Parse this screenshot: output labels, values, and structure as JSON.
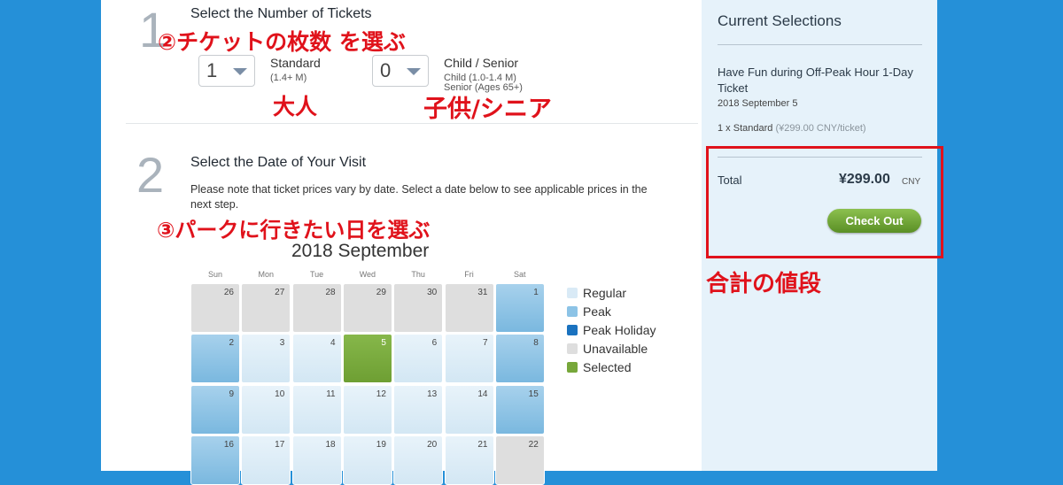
{
  "steps": {
    "step1": {
      "number": "1",
      "title": "Select the Number of Tickets",
      "standard": {
        "qty": "1",
        "label": "Standard",
        "sub": "(1.4+ M)"
      },
      "child": {
        "qty": "0",
        "label": "Child / Senior",
        "sub1": "Child (1.0-1.4 M)",
        "sub2": "Senior (Ages 65+)"
      }
    },
    "step2": {
      "number": "2",
      "title": "Select the Date of Your Visit",
      "note": "Please note that ticket prices vary by date. Select a date below to see applicable prices in the next step."
    }
  },
  "annotations": {
    "step2_jp": "②チケットの枚数 を選ぶ",
    "adult_jp": "大人",
    "child_jp": "子供/シニア",
    "step3_jp": "③パークに行きたい日を選ぶ",
    "total_jp": "合計の値段"
  },
  "calendar": {
    "title": "2018 September",
    "weekdays": [
      "Sun",
      "Mon",
      "Tue",
      "Wed",
      "Thu",
      "Fri",
      "Sat"
    ],
    "weeks": [
      [
        {
          "d": "26",
          "s": "unavailable"
        },
        {
          "d": "27",
          "s": "unavailable"
        },
        {
          "d": "28",
          "s": "unavailable"
        },
        {
          "d": "29",
          "s": "unavailable"
        },
        {
          "d": "30",
          "s": "unavailable"
        },
        {
          "d": "31",
          "s": "unavailable"
        },
        {
          "d": "1",
          "s": "peak"
        }
      ],
      [
        {
          "d": "2",
          "s": "peak"
        },
        {
          "d": "3",
          "s": "regular"
        },
        {
          "d": "4",
          "s": "regular"
        },
        {
          "d": "5",
          "s": "selected"
        },
        {
          "d": "6",
          "s": "regular"
        },
        {
          "d": "7",
          "s": "regular"
        },
        {
          "d": "8",
          "s": "peak"
        }
      ],
      [
        {
          "d": "9",
          "s": "peak"
        },
        {
          "d": "10",
          "s": "regular"
        },
        {
          "d": "11",
          "s": "regular"
        },
        {
          "d": "12",
          "s": "regular"
        },
        {
          "d": "13",
          "s": "regular"
        },
        {
          "d": "14",
          "s": "regular"
        },
        {
          "d": "15",
          "s": "peak"
        }
      ],
      [
        {
          "d": "16",
          "s": "peak"
        },
        {
          "d": "17",
          "s": "regular"
        },
        {
          "d": "18",
          "s": "regular"
        },
        {
          "d": "19",
          "s": "regular"
        },
        {
          "d": "20",
          "s": "regular"
        },
        {
          "d": "21",
          "s": "regular"
        },
        {
          "d": "22",
          "s": "unavailable"
        }
      ]
    ],
    "legend": [
      {
        "label": "Regular",
        "color": "#d9eaf6"
      },
      {
        "label": "Peak",
        "color": "#8cc3e6"
      },
      {
        "label": "Peak Holiday",
        "color": "#1a72bf"
      },
      {
        "label": "Unavailable",
        "color": "#dedede"
      },
      {
        "label": "Selected",
        "color": "#77a73a"
      }
    ]
  },
  "sidebar": {
    "title": "Current Selections",
    "ticket_name": "Have Fun during Off-Peak Hour 1-Day Ticket",
    "date": "2018 September 5",
    "line_item": "1 x Standard",
    "line_price": "(¥299.00 CNY/ticket)",
    "total_label": "Total",
    "total_amount": "¥299.00",
    "currency": "CNY",
    "checkout": "Check Out"
  },
  "colors": {
    "page_bg": "#2590d8",
    "annotation_red": "#e0121b",
    "checkout_green": "#6e9f33"
  }
}
